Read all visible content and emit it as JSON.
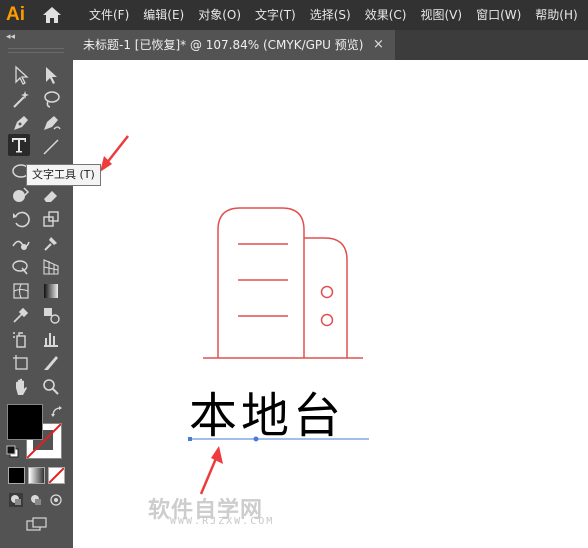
{
  "app": {
    "logo_text": "Ai",
    "accent": "#ff9a00"
  },
  "menu": {
    "items": [
      "文件(F)",
      "编辑(E)",
      "对象(O)",
      "文字(T)",
      "选择(S)",
      "效果(C)",
      "视图(V)",
      "窗口(W)",
      "帮助(H)"
    ]
  },
  "toolpanel": {
    "collapse_label": "◂◂"
  },
  "document_tab": {
    "title": "未标题-1 [已恢复]* @ 107.84% (CMYK/GPU 预览)",
    "close_label": "×"
  },
  "tooltip": {
    "text": "文字工具 (T)"
  },
  "canvas": {
    "text_object": "本地台"
  },
  "colors": {
    "artwork_stroke": "#e05050",
    "annotation_arrow": "#ee3b3b",
    "selection_blue": "#4a7bd8"
  },
  "watermark": {
    "text": "软件自学网",
    "sub": "WWW.RJZXW.COM"
  }
}
